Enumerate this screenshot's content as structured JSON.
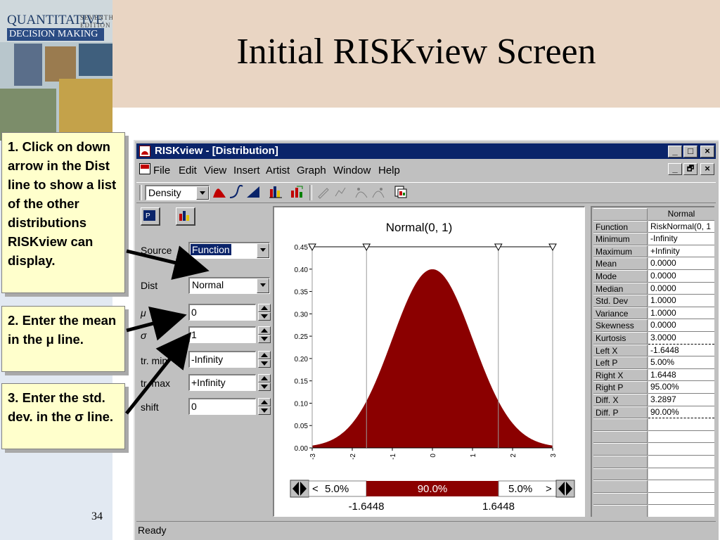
{
  "slide": {
    "title": "Initial RISKview Screen",
    "page_number": "34",
    "book": {
      "title_line1": "QUANTITATIVE",
      "title_line2": "DECISION MAKING",
      "edition_line1": "SEVENTH",
      "edition_line2": "EDITION"
    }
  },
  "callouts": [
    {
      "text": "1. Click on down arrow in the Dist line to show a list of the other distributions RISKview can display."
    },
    {
      "text": "2.  Enter the mean in the μ line."
    },
    {
      "text": "3.  Enter the std. dev. in the σ line."
    }
  ],
  "window": {
    "title": "RISKview - [Distribution]",
    "controls": {
      "minimize": "_",
      "maximize": "□",
      "close": "×",
      "restore": "🗗"
    },
    "menu": [
      "File",
      "Edit",
      "View",
      "Insert",
      "Artist",
      "Graph",
      "Window",
      "Help"
    ],
    "toolbar": {
      "view_mode": "Density"
    },
    "status": "Ready"
  },
  "inputs": {
    "source_label": "Source",
    "source_value": "Function",
    "dist_label": "Dist",
    "dist_value": "Normal",
    "mu_label": "μ",
    "mu_value": "0",
    "sigma_label": "σ",
    "sigma_value": "1",
    "trmin_label": "tr. min",
    "trmin_value": "-Infinity",
    "trmax_label": "tr. max",
    "trmax_value": "+Infinity",
    "shift_label": "shift",
    "shift_value": "0"
  },
  "chart_data": {
    "type": "area",
    "title": "Normal(0, 1)",
    "distribution": "normal",
    "mean": 0,
    "std": 1,
    "xlim": [
      -3,
      3
    ],
    "ylim": [
      0,
      0.45
    ],
    "x_ticks": [
      "-3",
      "-2",
      "-1",
      "0",
      "1",
      "2",
      "3"
    ],
    "y_ticks": [
      "0.00",
      "0.05",
      "0.10",
      "0.15",
      "0.20",
      "0.25",
      "0.30",
      "0.35",
      "0.40",
      "0.45"
    ],
    "markers": [
      -3,
      -1.6448,
      1.6448,
      3
    ],
    "fill_color": "#8b0000",
    "bottom_bar": {
      "left_pct": "5.0%",
      "middle_pct": "90.0%",
      "right_pct": "5.0%",
      "left_value": "-1.6448",
      "right_value": "1.6448",
      "left_prefix": "<",
      "right_suffix": ">"
    }
  },
  "stats": {
    "header": "Normal",
    "rows": [
      {
        "name": "Function",
        "value": "RiskNormal(0, 1"
      },
      {
        "name": "Minimum",
        "value": "-Infinity"
      },
      {
        "name": "Maximum",
        "value": "+Infinity"
      },
      {
        "name": "Mean",
        "value": "0.0000"
      },
      {
        "name": "Mode",
        "value": "0.0000"
      },
      {
        "name": "Median",
        "value": "0.0000"
      },
      {
        "name": "Std. Dev",
        "value": "1.0000"
      },
      {
        "name": "Variance",
        "value": "1.0000"
      },
      {
        "name": "Skewness",
        "value": "0.0000"
      },
      {
        "name": "Kurtosis",
        "value": "3.0000"
      },
      {
        "name": "Left X",
        "value": "-1.6448"
      },
      {
        "name": "Left P",
        "value": "5.00%"
      },
      {
        "name": "Right X",
        "value": "1.6448"
      },
      {
        "name": "Right P",
        "value": "95.00%"
      },
      {
        "name": "Diff. X",
        "value": "3.2897"
      },
      {
        "name": "Diff. P",
        "value": "90.00%"
      }
    ]
  }
}
